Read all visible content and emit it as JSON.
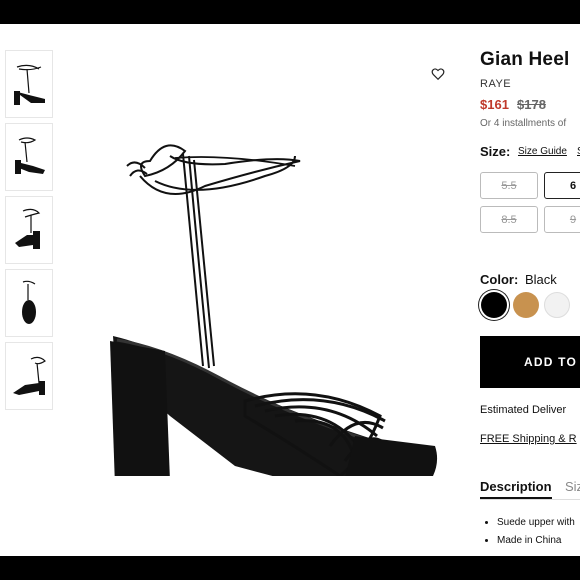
{
  "product": {
    "title": "Gian Heel",
    "brand": "RAYE",
    "price_sale": "$161",
    "price_original": "$178",
    "installments": "Or 4 installments of"
  },
  "size": {
    "label": "Size:",
    "guide_link": "Size Guide",
    "extra_link": "S",
    "options": [
      {
        "label": "5.5",
        "available": false
      },
      {
        "label": "6",
        "available": true
      },
      {
        "label": "8.5",
        "available": false
      },
      {
        "label": "9",
        "available": false
      }
    ]
  },
  "color": {
    "label": "Color:",
    "selected": "Black",
    "swatches": [
      {
        "name": "Black",
        "hex": "#000000",
        "selected": true
      },
      {
        "name": "Tan",
        "hex": "#c8924f",
        "selected": false
      },
      {
        "name": "White",
        "hex": "#f2f2f2",
        "selected": false
      }
    ]
  },
  "cart": {
    "add_label": "ADD TO"
  },
  "shipping": {
    "estimated": "Estimated Deliver",
    "free": "FREE Shipping & R"
  },
  "tabs": [
    {
      "label": "Description",
      "active": true
    },
    {
      "label": "Siz",
      "active": false
    }
  ],
  "description": {
    "bullets": [
      "Suede upper with",
      "Made in China"
    ]
  },
  "colors": {
    "sale": "#c0392b",
    "button": "#000000"
  }
}
